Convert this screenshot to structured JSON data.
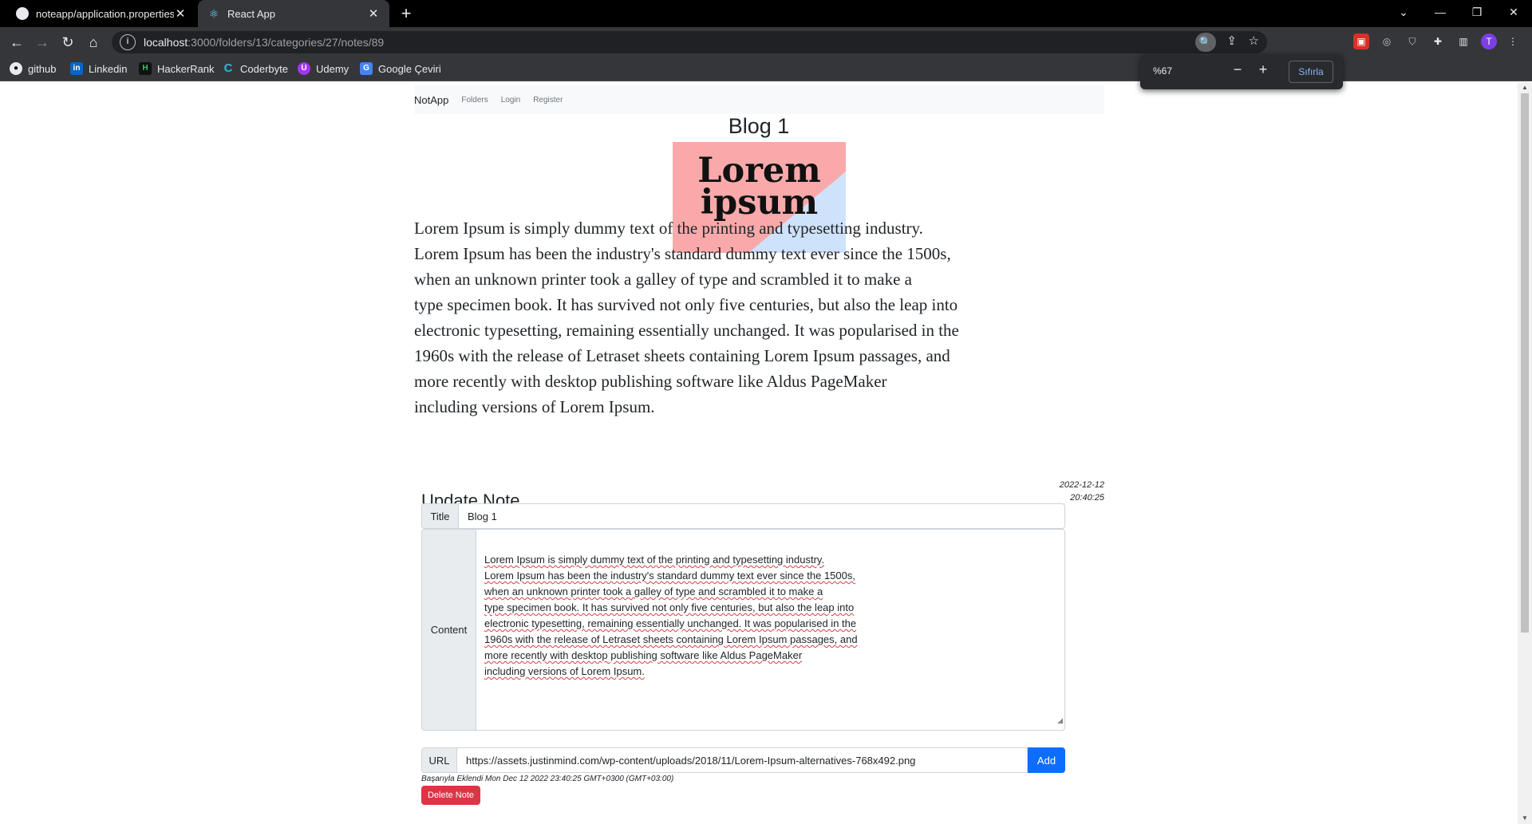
{
  "browser": {
    "tabs": [
      {
        "title": "noteapp/application.properties a",
        "active": false,
        "icon": "github-icon"
      },
      {
        "title": "React App",
        "active": true,
        "icon": "react-icon"
      }
    ],
    "address": {
      "host": "localhost",
      "rest": ":3000/folders/13/categories/27/notes/89"
    },
    "bookmarks": [
      {
        "label": "github",
        "icon": "github-icon"
      },
      {
        "label": "Linkedin",
        "icon": "linkedin-icon"
      },
      {
        "label": "HackerRank",
        "icon": "hackerrank-icon"
      },
      {
        "label": "Coderbyte",
        "icon": "coderbyte-icon"
      },
      {
        "label": "Udemy",
        "icon": "udemy-icon"
      },
      {
        "label": "Google Çeviri",
        "icon": "google-translate-icon"
      }
    ],
    "zoom": {
      "level": "%67",
      "reset_label": "Sıfırla"
    }
  },
  "app": {
    "brand": "NotApp",
    "nav": [
      "Folders",
      "Login",
      "Register"
    ]
  },
  "note": {
    "title": "Blog 1",
    "image_text": [
      "Lorem",
      "ipsum"
    ],
    "body": "Lorem Ipsum is simply dummy text of the printing and typesetting industry.\nLorem Ipsum has been the industry's standard dummy text ever since the 1500s,\nwhen an unknown printer took a galley of type and scrambled it to make a\ntype specimen book. It has survived not only five centuries, but also the leap into\nelectronic typesetting, remaining essentially unchanged. It was popularised in the\n1960s with the release of Letraset sheets containing Lorem Ipsum passages, and\nmore recently with desktop publishing software like Aldus PageMaker\nincluding versions of Lorem Ipsum.",
    "date": "2022-12-12",
    "time": "20:40:25"
  },
  "form": {
    "heading": "Update Note",
    "title_label": "Title",
    "title_value": "Blog 1",
    "content_label": "Content",
    "url_label": "URL",
    "url_value": "https://assets.justinmind.com/wp-content/uploads/2018/11/Lorem-Ipsum-alternatives-768x492.png",
    "add_label": "Add",
    "success_message": "Başarıyla Eklendi Mon Dec 12 2022 23:40:25 GMT+0300 (GMT+03:00)",
    "delete_label": "Delete Note"
  },
  "colors": {
    "primary": "#0d6efd",
    "danger": "#dc3545",
    "image_pink": "#f9a9a9",
    "image_blue": "#cfe2fb"
  }
}
